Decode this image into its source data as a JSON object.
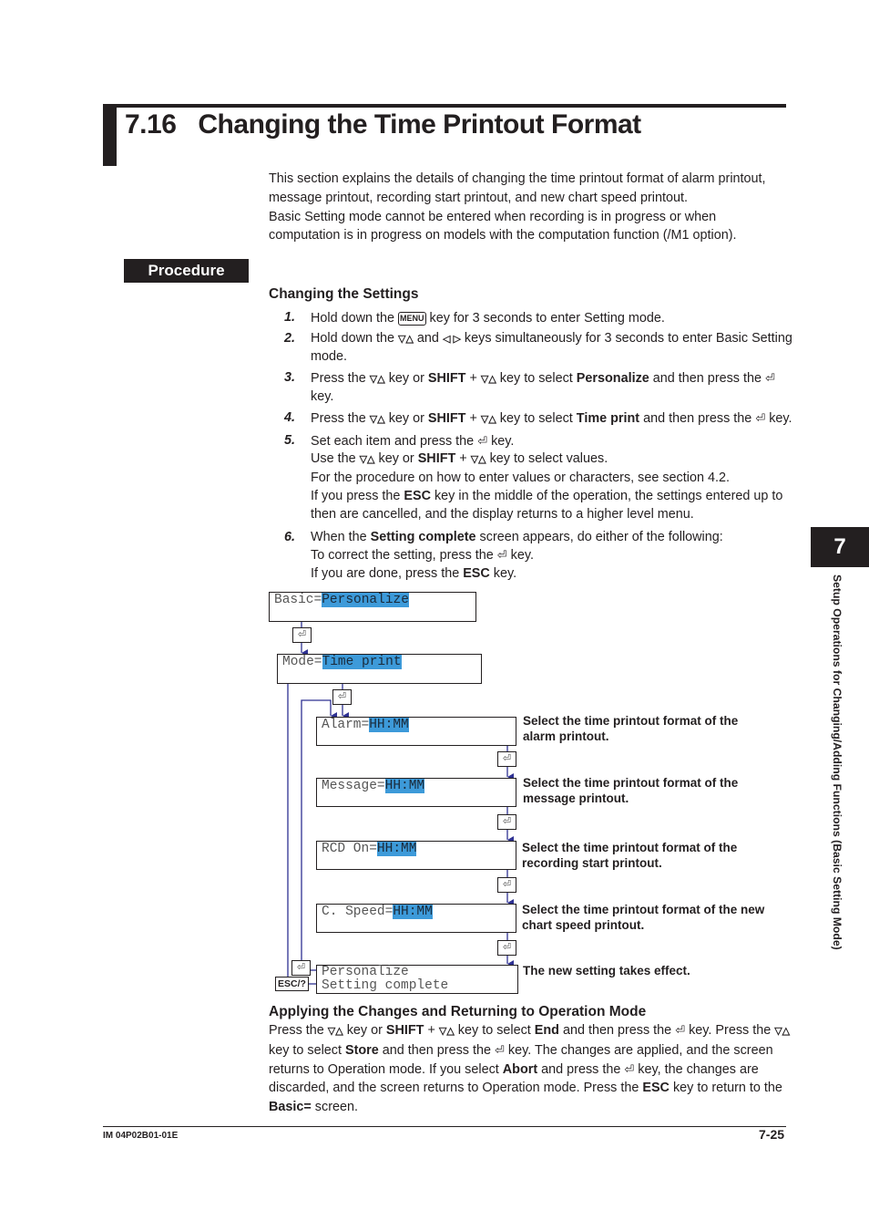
{
  "heading": {
    "number": "7.16",
    "title": "Changing the Time Printout Format"
  },
  "intro": [
    "This section explains the details of changing the time printout format of alarm printout, message printout, recording start printout, and new chart speed printout.",
    "Basic Setting mode cannot be entered when recording is in progress or when computation is in progress on models with the computation function (/M1 option)."
  ],
  "procedure_label": "Procedure",
  "changing_settings": {
    "heading": "Changing the Settings",
    "keys": {
      "menu": "MENU",
      "updown": "▽△",
      "left_right": "◁ ▷",
      "enter": "⏎",
      "shift": "SHIFT",
      "esc": "ESC"
    },
    "steps": [
      {
        "n": "1.",
        "a": "Hold down the ",
        "b": " key for 3 seconds to enter Setting mode."
      },
      {
        "n": "2.",
        "a": "Hold down the ",
        "b": " and ",
        "c": " keys simultaneously for 3 seconds to enter Basic Setting mode."
      },
      {
        "n": "3.",
        "a": "Press the ",
        "b": " key or ",
        "c": " + ",
        "d": " key to select ",
        "bold": "Personalize",
        "e": " and then press the ",
        "f": " key."
      },
      {
        "n": "4.",
        "a": "Press the ",
        "b": " key or ",
        "c": " + ",
        "d": " key to select ",
        "bold": "Time print",
        "e": " and then press the ",
        "f": " key."
      },
      {
        "n": "5.",
        "a": "Set each item and press the ",
        "b": " key.",
        "l2a": "Use the ",
        "l2b": " key or ",
        "l2c": " + ",
        "l2d": " key to select values.",
        "l3": "For the procedure on how to enter values or characters, see section 4.2.",
        "l4a": "If you press the ",
        "l4b": " key in the middle of the operation, the settings entered up to then are cancelled, and the display returns to a higher level menu."
      },
      {
        "n": "6.",
        "a": "When the ",
        "bold": "Setting complete",
        "b": " screen appears, do either of the following:",
        "l2a": "To correct the setting, press the ",
        "l2b": " key.",
        "l3a": "If you are done, press the ",
        "l3b": " key."
      }
    ]
  },
  "diagram": {
    "screens": [
      {
        "label": "Basic=",
        "value": "Personalize"
      },
      {
        "label": "Mode=",
        "value": "Time print"
      },
      {
        "label": "Alarm=",
        "value": "HH:MM",
        "desc": "Select the time printout format of the alarm printout."
      },
      {
        "label": "Message=",
        "value": "HH:MM",
        "desc": "Select the time printout format of the message printout."
      },
      {
        "label": "RCD On=",
        "value": "HH:MM",
        "desc": "Select the time printout format of the recording start printout."
      },
      {
        "label": "C. Speed=",
        "value": "HH:MM",
        "desc": "Select the time printout format of the new chart speed printout."
      },
      {
        "line1": "Personalize",
        "line2": "Setting complete",
        "desc": "The new setting takes effect."
      }
    ],
    "esc_key": "ESC/?",
    "enter_key": "⏎"
  },
  "apply": {
    "heading": "Applying the Changes and Returning to Operation Mode",
    "t1": "Press the ",
    "t2": " key or ",
    "shift": "SHIFT",
    "t3": " + ",
    "t4": " key to select ",
    "end": "End",
    "t5": " and then press the ",
    "t6": " key. Press the ",
    "t7": " key to select ",
    "store": "Store",
    "t8": " and then press the ",
    "t9": " key. The changes are applied, and the screen returns to Operation mode. If you select ",
    "abort": "Abort",
    "t10": " and press the ",
    "t11": " key, the changes are discarded, and the screen returns to Operation mode. Press the ",
    "esc": "ESC",
    "t12": " key to return to the ",
    "basic": "Basic=",
    "t13": " screen."
  },
  "footer": {
    "doc_id": "IM 04P02B01-01E",
    "page": "7-25"
  },
  "chapter": {
    "number": "7",
    "title": "Setup Operations for Changing/Adding Functions (Basic Setting Mode)"
  }
}
